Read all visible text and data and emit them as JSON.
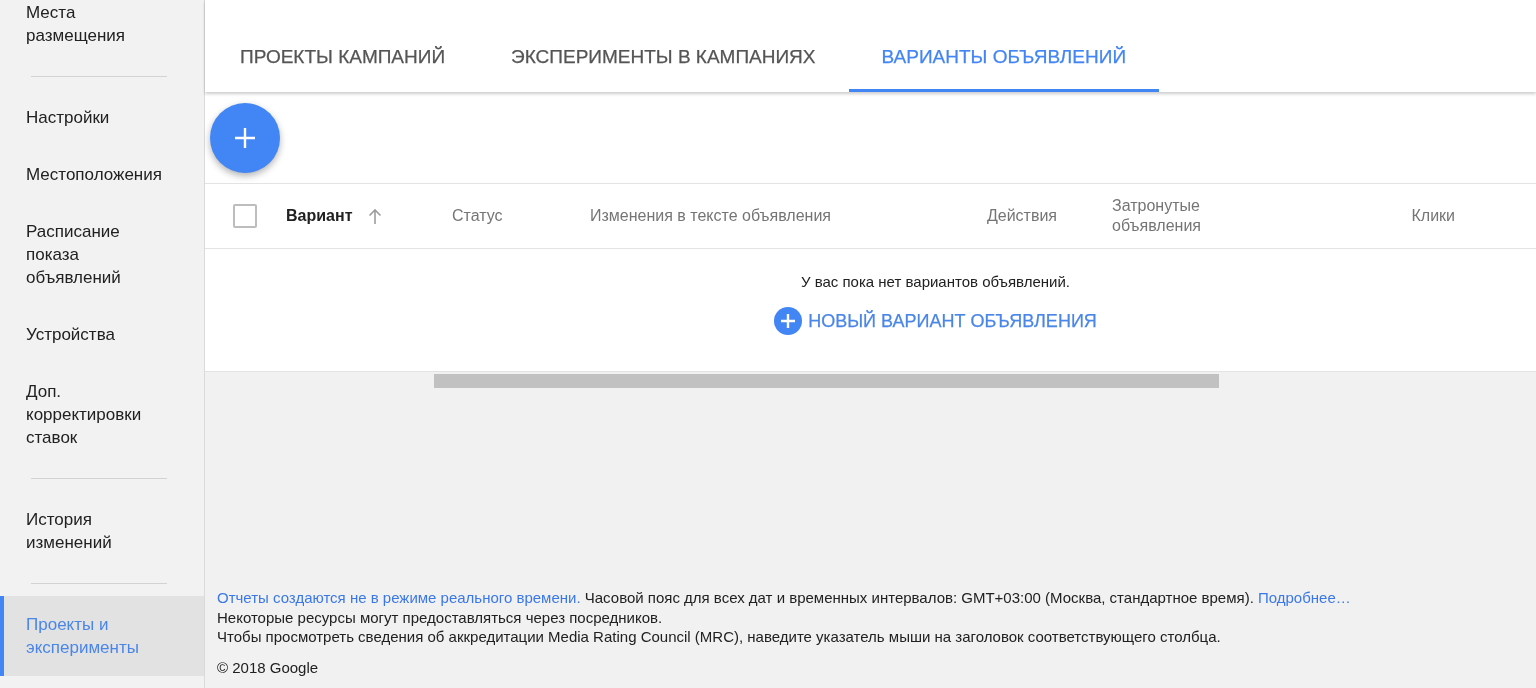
{
  "sidebar": {
    "groups": [
      {
        "items": [
          {
            "label": "Места размещения",
            "selected": false
          }
        ]
      },
      {
        "items": [
          {
            "label": "Настройки",
            "selected": false
          },
          {
            "label": "Местоположения",
            "selected": false
          },
          {
            "label": "Расписание показа объявлений",
            "selected": false
          },
          {
            "label": "Устройства",
            "selected": false
          },
          {
            "label": "Доп. корректировки ставок",
            "selected": false
          }
        ]
      },
      {
        "items": [
          {
            "label": "История изменений",
            "selected": false
          }
        ]
      },
      {
        "items": [
          {
            "label": "Проекты и эксперименты",
            "selected": true
          }
        ]
      }
    ]
  },
  "tabs": [
    {
      "label": "ПРОЕКТЫ КАМПАНИЙ",
      "selected": false
    },
    {
      "label": "ЭКСПЕРИМЕНТЫ В КАМПАНИЯХ",
      "selected": false
    },
    {
      "label": "ВАРИАНТЫ ОБЪЯВЛЕНИЙ",
      "selected": true
    }
  ],
  "table": {
    "select_all": {
      "checked": false
    },
    "columns": [
      {
        "label": "Вариант",
        "kind": "text",
        "sorted": true
      },
      {
        "label": "Статус",
        "kind": "text",
        "sorted": false
      },
      {
        "label": "Изменения в тексте объявления",
        "kind": "text",
        "sorted": false
      },
      {
        "label": "Действия",
        "kind": "numeric",
        "sorted": false
      },
      {
        "label": "Затронутые объявления",
        "kind": "numeric",
        "sorted": false
      },
      {
        "label": "Клики",
        "kind": "numeric",
        "sorted": false
      }
    ],
    "empty_message": "У вас пока нет вариантов объявлений.",
    "new_variant_link": "НОВЫЙ ВАРИАНТ ОБЪЯВЛЕНИЯ"
  },
  "footer": {
    "notes": [
      {
        "parts": [
          {
            "kind": "link",
            "text": "Отчеты создаются не в режиме реального времени."
          },
          {
            "kind": "text",
            "text": " Часовой пояс для всех дат и временных интервалов: GMT+03:00 (Москва, стандартное время). "
          },
          {
            "kind": "link",
            "text": "Подробнее…"
          }
        ]
      },
      {
        "parts": [
          {
            "kind": "text",
            "text": "Некоторые ресурсы могут предоставляться через посредников."
          }
        ]
      },
      {
        "parts": [
          {
            "kind": "text",
            "text": "Чтобы просмотреть сведения об аккредитации Media Rating Council (MRC), наведите указатель мыши на заголовок соответствующего столбца."
          }
        ]
      }
    ],
    "copyright": "© 2018 Google"
  }
}
